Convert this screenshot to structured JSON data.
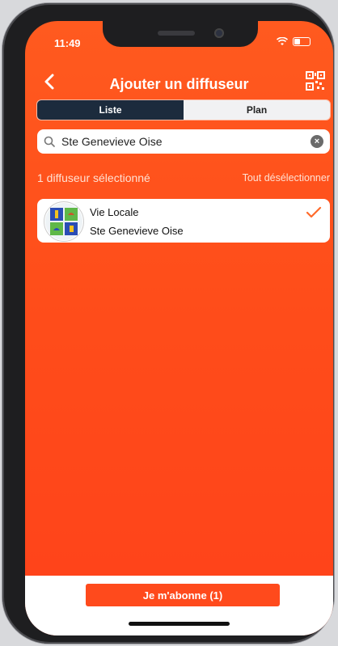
{
  "status": {
    "time": "11:49"
  },
  "header": {
    "title": "Ajouter un diffuseur"
  },
  "segments": [
    {
      "label": "Liste",
      "active": true
    },
    {
      "label": "Plan",
      "active": false
    }
  ],
  "search": {
    "value": "Ste Genevieve Oise",
    "placeholder": ""
  },
  "selection": {
    "count_label": "1 diffuseur sélectionné",
    "clear_all": "Tout désélectionner"
  },
  "results": [
    {
      "name": "Vie Locale",
      "location": "Ste Genevieve Oise",
      "selected": true
    }
  ],
  "footer": {
    "subscribe_label": "Je m'abonne (1)"
  },
  "colors": {
    "accent": "#ff4a1c",
    "segment_active": "#1c2b3d"
  }
}
